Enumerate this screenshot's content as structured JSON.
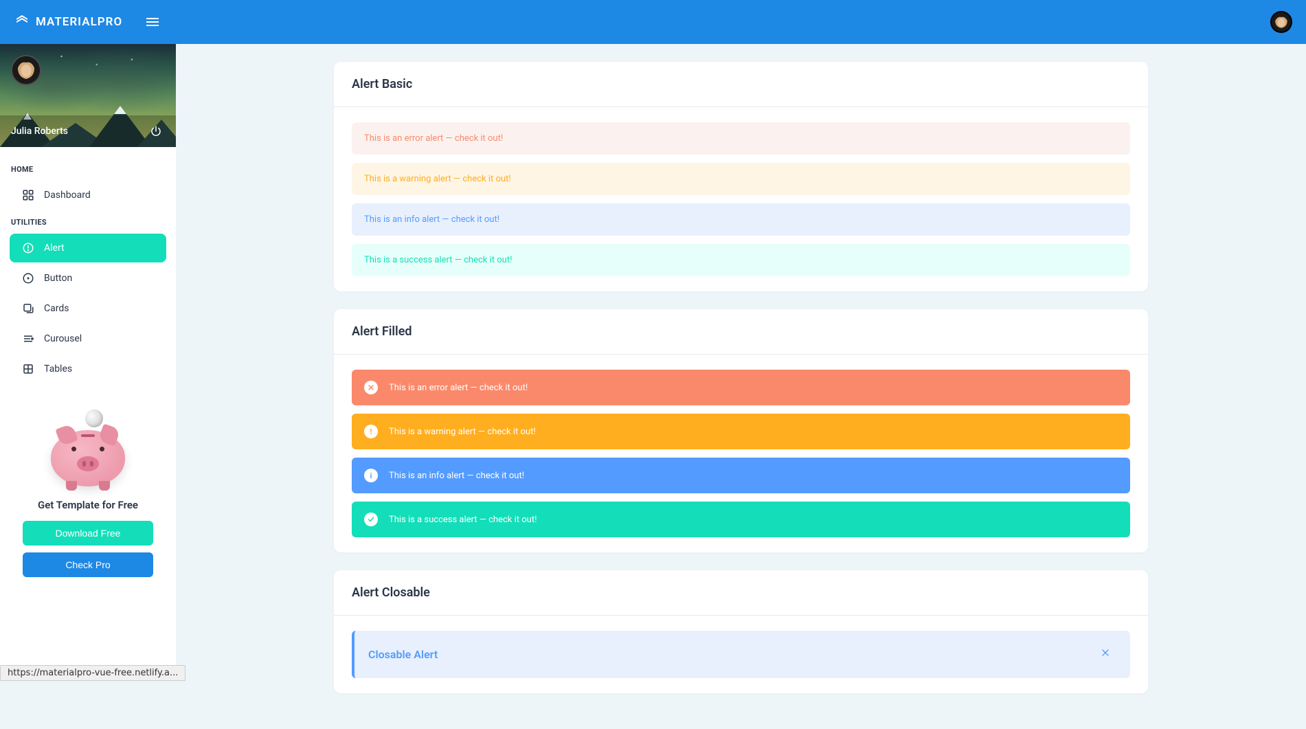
{
  "brand": "MATERIALPRO",
  "user": {
    "name": "Julia Roberts"
  },
  "sidebar": {
    "sections": [
      {
        "heading": "HOME",
        "items": [
          {
            "label": "Dashboard",
            "icon": "dashboard"
          }
        ]
      },
      {
        "heading": "UTILITIES",
        "items": [
          {
            "label": "Alert",
            "icon": "alert",
            "active": true
          },
          {
            "label": "Button",
            "icon": "button"
          },
          {
            "label": "Cards",
            "icon": "cards"
          },
          {
            "label": "Curousel",
            "icon": "carousel"
          },
          {
            "label": "Tables",
            "icon": "tables"
          }
        ]
      }
    ],
    "promo": {
      "title": "Get Template for Free",
      "download_label": "Download Free",
      "check_label": "Check Pro"
    }
  },
  "cards": {
    "basic": {
      "title": "Alert Basic",
      "alerts": [
        {
          "type": "error",
          "text": "This is an error alert — check it out!"
        },
        {
          "type": "warning",
          "text": "This is a warning alert — check it out!"
        },
        {
          "type": "info",
          "text": "This is an info alert — check it out!"
        },
        {
          "type": "success",
          "text": "This is a success alert — check it out!"
        }
      ]
    },
    "filled": {
      "title": "Alert Filled",
      "alerts": [
        {
          "type": "error",
          "text": "This is an error alert — check it out!"
        },
        {
          "type": "warning",
          "text": "This is a warning alert — check it out!"
        },
        {
          "type": "info",
          "text": "This is an info alert — check it out!"
        },
        {
          "type": "success",
          "text": "This is a success alert — check it out!"
        }
      ]
    },
    "closable": {
      "title": "Alert Closable",
      "alert_title": "Closable Alert"
    }
  },
  "status_url": "https://materialpro-vue-free.netlify.a..."
}
